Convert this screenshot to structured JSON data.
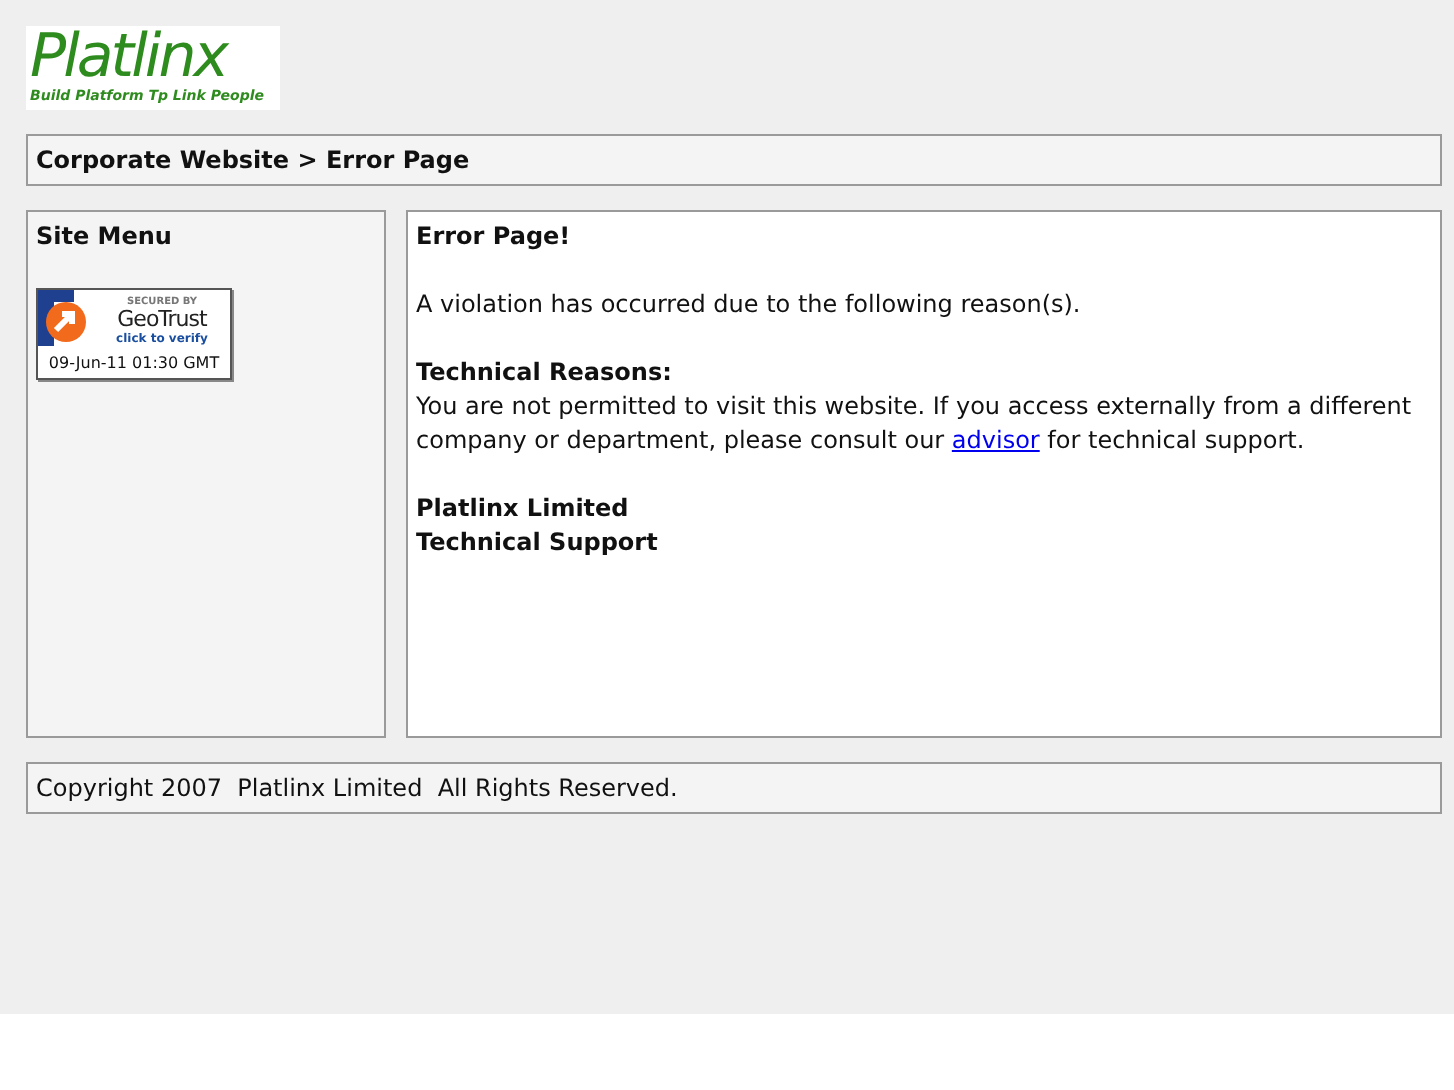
{
  "logo": {
    "name": "Platlinx",
    "tagline": "Build Platform Tp Link People"
  },
  "breadcrumb": "Corporate Website > Error Page",
  "sidebar": {
    "title": "Site Menu",
    "badge": {
      "top": "SECURED BY",
      "brand": "GeoTrust",
      "action": "click to verify",
      "date": "09-Jun-11 01:30 GMT"
    }
  },
  "main": {
    "title": "Error Page!",
    "intro": "A violation has occurred due to the following reason(s).",
    "reasons_heading": "Technical Reasons:",
    "reason_before": "You are not permitted to visit this website. If you access externally from a different company or department, please consult our ",
    "reason_link": "advisor",
    "reason_after": " for technical support.",
    "signature": [
      "Platlinx Limited",
      "Technical Support"
    ]
  },
  "footer": "Copyright 2007  Platlinx Limited  All Rights Reserved."
}
